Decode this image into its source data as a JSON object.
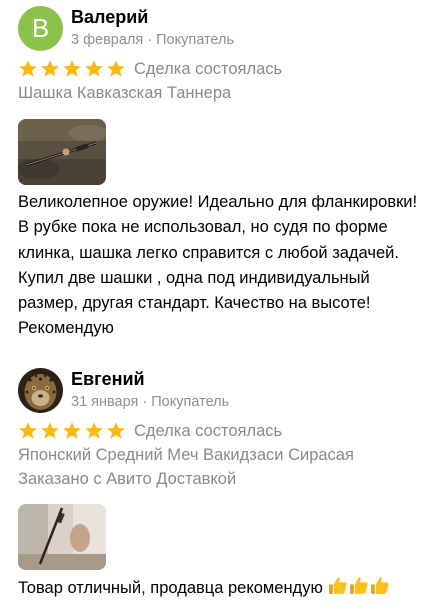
{
  "reviews": [
    {
      "avatar_letter": "В",
      "author": "Валерий",
      "meta": "3 февраля · Покупатель",
      "rating": 5,
      "deal_status": "Сделка состоялась",
      "item_title": "Шашка Кавказская Таннера",
      "delivery_note": "",
      "text": "Великолепное оружие! Идеально для фланкировки! В рубке пока не использовал, но судя по форме клинка, шашка легко справится с любой задачей. Купил две шашки , одна под индивидуальный размер, другая стандарт. Качество на высоте! Рекомендую"
    },
    {
      "avatar_letter": "",
      "author": "Евгений",
      "meta": "31 января · Покупатель",
      "rating": 5,
      "deal_status": "Сделка состоялась",
      "item_title": "Японский Средний Меч Вакидзаси Сирасая",
      "delivery_note": "Заказано с Авито Доставкой",
      "text": "Товар отличный, продавца рекомендую"
    }
  ],
  "colors": {
    "star": "#fdb913",
    "avatar_bg": "#8bc34a",
    "muted_text": "#8a8a8a"
  },
  "icons": {
    "star": "star-icon",
    "thumbs_up": "thumbs-up-icon"
  }
}
